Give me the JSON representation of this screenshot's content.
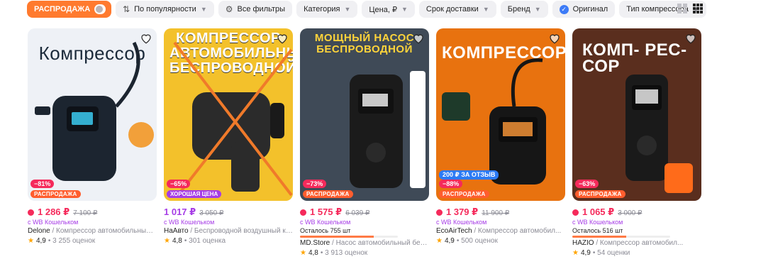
{
  "filters": {
    "sale_label": "РАСПРОДАЖА",
    "sort_label": "По популярности",
    "all_filters_label": "Все фильтры",
    "category_label": "Категория",
    "price_label": "Цена, ₽",
    "delivery_label": "Срок доставки",
    "brand_label": "Бренд",
    "original_label": "Оригинал",
    "compressor_type_label": "Тип компрессора"
  },
  "colors": {
    "accent": "#ff7a2e",
    "price": "#f52a5b",
    "wallet": "#a63ce6",
    "blue": "#2c7bf6"
  },
  "products": [
    {
      "image_title": "Компрессор",
      "image_bg": "#f4f6f9",
      "discount": "−81%",
      "badge": "РАСПРОДАЖА",
      "price": "1 286 ₽",
      "old_price": "7 100 ₽",
      "wallet": "с WB Кошельком",
      "brand": "Delone",
      "name": " / Компрессор автомобильный от...",
      "rating": "4,9",
      "reviews": "• 3 255 оценок"
    },
    {
      "image_title": "КОМПРЕССОР АВТОМОБИЛЬНЫЙ БЕСПРОВОДНОЙ",
      "image_bg": "#f3c12b",
      "discount": "−65%",
      "badge": "ХОРОШАЯ ЦЕНА",
      "price": "1 017 ₽",
      "old_price": "3 050 ₽",
      "wallet": "с WB Кошельком",
      "brand": "НаАвто",
      "name": " / Беспроводной воздушный ком...",
      "rating": "4,8",
      "reviews": "• 301 оценка"
    },
    {
      "image_title": "МОЩНЫЙ НАСОС БЕСПРОВОДНОЙ",
      "image_bg": "#3f4a57",
      "discount": "−73%",
      "badge": "РАСПРОДАЖА",
      "price": "1 575 ₽",
      "old_price": "6 039 ₽",
      "wallet": "с WB Кошельком",
      "stock": "Осталось 755 шт",
      "stock_level": 0.75,
      "brand": "MD.Store",
      "name": " / Насос автомобильный беспр...",
      "rating": "4,8",
      "reviews": "• 3 913 оценок"
    },
    {
      "image_title": "КОМПРЕССОР",
      "image_bg": "#e8720f",
      "discount": "−88%",
      "extra_badge": "200 ₽ ЗА ОТЗЫВ",
      "badge": "РАСПРОДАЖА",
      "price": "1 379 ₽",
      "old_price": "11 900 ₽",
      "wallet": "с WB Кошельком",
      "brand": "EcoAirTech",
      "name": " / Компрессор автомобил...",
      "rating": "4,9",
      "reviews": "• 500 оценок"
    },
    {
      "image_title": "КОМП- РЕС- СОР",
      "image_bg": "#5a2e1e",
      "discount": "−63%",
      "badge": "РАСПРОДАЖА",
      "price": "1 065 ₽",
      "old_price": "3 000 ₽",
      "wallet": "с WB Кошельком",
      "stock": "Осталось 516 шт",
      "stock_level": 0.55,
      "brand": "HAZIO",
      "name": " / Компрессор автомобил...",
      "rating": "4,9",
      "reviews": "• 54 оценки"
    }
  ]
}
